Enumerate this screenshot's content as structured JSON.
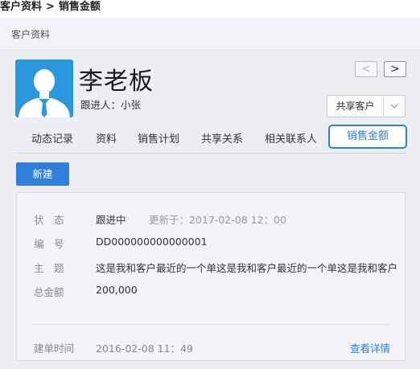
{
  "breadcrumb": {
    "parent": "客户资料",
    "separator": ">",
    "current": "销售金额"
  },
  "panel": {
    "header_title": "客户资料"
  },
  "customer": {
    "name": "李老板",
    "follower": "跟进人：小张",
    "avatar_icon": "user-avatar-icon"
  },
  "header_actions": {
    "prev_label": "<",
    "next_label": ">",
    "share_label": "共享客户",
    "share_dropdown_icon": "chevron-down-icon"
  },
  "tabs": [
    {
      "label": "动态记录"
    },
    {
      "label": "资料"
    },
    {
      "label": "销售计划"
    },
    {
      "label": "共享关系"
    },
    {
      "label": "相关联系人"
    },
    {
      "label": "销售金额",
      "active": true
    }
  ],
  "new_button": "新建",
  "record": {
    "status_label": "状　态",
    "status_value": "跟进中",
    "updated": "更新于：2017-02-08  12：00",
    "number_label": "编　号",
    "number_value": "DD000000000000001",
    "subject_label": "主　题",
    "subject_value": "这是我和客户最近的一个单这是我和客户最近的一个单这是我和客户",
    "amount_label": "总金额",
    "amount_value": "200,000",
    "created_label": "建单时间",
    "created_value": "2016-02-08  11：49",
    "details_link": "查看详情"
  },
  "colors": {
    "accent": "#2e7fd7",
    "avatar_bg": "#2b97dd",
    "panel_bg": "#edeef2"
  }
}
